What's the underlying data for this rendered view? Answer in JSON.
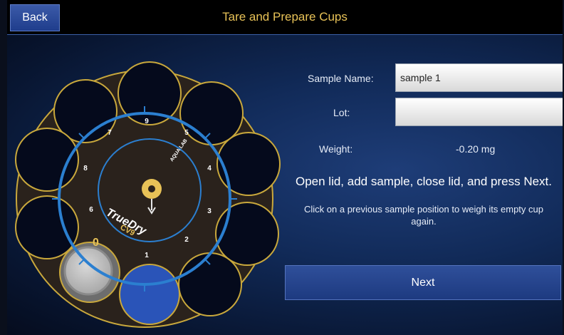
{
  "header": {
    "back_label": "Back",
    "title": "Tare and Prepare Cups"
  },
  "form": {
    "sample_name_label": "Sample Name:",
    "sample_name_value": "sample 1",
    "lot_label": "Lot:",
    "lot_value": "",
    "weight_label": "Weight:",
    "weight_value": "-0.20 mg"
  },
  "instruction": "Open lid, add sample, close lid, and press Next.",
  "hint": "Click on a previous sample position to weigh its empty cup again.",
  "next_label": "Next",
  "carousel": {
    "brand": "TrueDry",
    "model": "CV9",
    "logo_text": "AQUA LAB",
    "position_numbers": [
      "1",
      "2",
      "3",
      "4",
      "5",
      "6",
      "7",
      "8",
      "9"
    ],
    "zero_mark": "0",
    "brand_color": "#e8c257",
    "ring_color": "#2b7fd0",
    "cup_border_color": "#c9a83c"
  }
}
